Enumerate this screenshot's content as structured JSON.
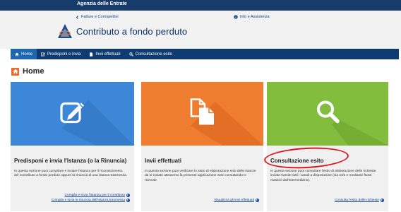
{
  "topbar": {
    "brand": "Agenzia delle Entrate"
  },
  "header": {
    "crumb_left": "Fatture e Corrispettivi",
    "crumb_right": "Info e Assistenza",
    "app_title": "Contributo a fondo perduto"
  },
  "nav": {
    "items": [
      {
        "label": "Home",
        "icon": "home-icon",
        "active": true
      },
      {
        "label": "Predisponi e invia",
        "icon": "edit-icon",
        "active": false
      },
      {
        "label": "Invii effettuati",
        "icon": "file-icon",
        "active": false
      },
      {
        "label": "Consultazione esito",
        "icon": "search-icon",
        "active": false
      }
    ]
  },
  "page": {
    "title": "Home"
  },
  "cards": [
    {
      "title": "Predisponi e invia l'Istanza (o la Rinuncia)",
      "description": "In questa sezione puoi compilare e inviare l'istanza per il riconoscimento del Contributo a fondo perduto oppure la rinuncia di una istanza trasmessa.",
      "links": [
        "Compila e invia l'istanza per il contributo",
        "Compila e invia la rinuncia dell'istanza trasmessa"
      ],
      "icon": "edit-icon",
      "color": "#3d87d9"
    },
    {
      "title": "Invii effettuati",
      "description": "In questa sezione puoi verificare lo stato di elaborazione solo delle istanze da te inviate attraverso la presente applicazione web consultando le ricevute.",
      "links": [
        "Visualizza gli invii effettuati"
      ],
      "icon": "files-icon",
      "color": "#ef7d2f"
    },
    {
      "title": "Consultazione esito",
      "description": "In questa sezione puoi consultare l'esito di elaborazione delle richieste inviate tramite tutti i canali a disposizione (via web e mediante flussi massivi dall'intermediario).",
      "links": [
        "Consulta l'esito delle richieste"
      ],
      "icon": "search-icon",
      "color": "#83bd3e"
    }
  ],
  "colors": {
    "topbar": "#173b6b",
    "nav": "#0f3c70",
    "nav_active": "#1d66b0",
    "accent_orange": "#ec6a2b",
    "annotation_red": "#e0141c"
  }
}
